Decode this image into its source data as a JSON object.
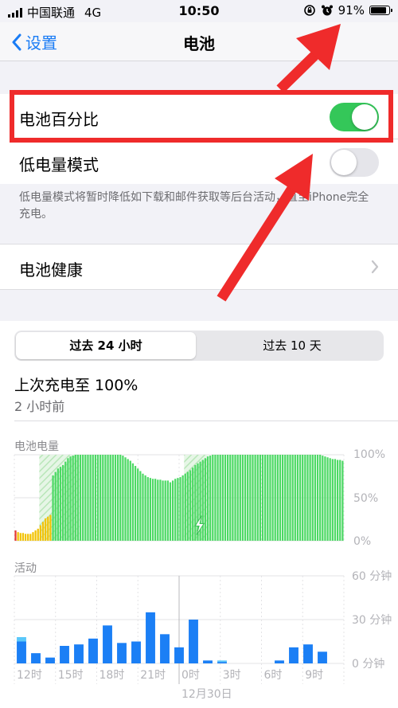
{
  "status_bar": {
    "carrier": "中国联通",
    "network": "4G",
    "time": "10:50",
    "battery_percent": "91%",
    "battery_level": 0.91
  },
  "nav": {
    "back_label": "设置",
    "title": "电池"
  },
  "settings": {
    "battery_percentage": {
      "label": "电池百分比",
      "on": true
    },
    "low_power_mode": {
      "label": "低电量模式",
      "on": false
    },
    "low_power_note": "低电量模式将暂时降低如下载和邮件获取等后台活动，直至iPhone完全充电。",
    "battery_health": {
      "label": "电池健康"
    }
  },
  "usage": {
    "tabs": [
      "过去 24 小时",
      "过去 10 天"
    ],
    "selected_tab": 0,
    "last_charge_title": "上次充电至 100%",
    "last_charge_ago": "2 小时前",
    "battery_level_label": "电池电量",
    "activity_label": "活动",
    "date_label": "12月30日"
  },
  "colors": {
    "accent": "#1a7cf5",
    "toggle_on": "#34c759",
    "toggle_off": "#e5e5ea",
    "battery_green": "#4cd964",
    "battery_yellow": "#f2c200",
    "battery_red": "#e53935",
    "activity_blue": "#1b7ff5",
    "activity_light_blue": "#5ac8fa",
    "annotation_red": "#ef2b2b"
  },
  "chart_data": [
    {
      "type": "bar",
      "title": "电池电量",
      "y_ticks": [
        "100%",
        "50%",
        "0%"
      ],
      "ylim": [
        0,
        100
      ],
      "grid": true,
      "values": [
        12,
        10,
        9,
        9,
        8,
        8,
        8,
        10,
        12,
        14,
        18,
        22,
        26,
        28,
        30,
        76,
        80,
        84,
        86,
        88,
        92,
        96,
        98,
        99,
        100,
        100,
        100,
        100,
        100,
        100,
        100,
        100,
        100,
        100,
        100,
        100,
        100,
        100,
        100,
        100,
        100,
        100,
        100,
        99,
        97,
        95,
        93,
        90,
        87,
        84,
        81,
        78,
        76,
        74,
        73,
        72,
        72,
        71,
        71,
        70,
        70,
        70,
        68,
        70,
        72,
        73,
        74,
        76,
        78,
        80,
        82,
        85,
        88,
        90,
        92,
        94,
        96,
        98,
        99,
        100,
        100,
        100,
        100,
        100,
        100,
        100,
        100,
        100,
        100,
        100,
        100,
        100,
        100,
        100,
        100,
        100,
        100,
        100,
        100,
        100,
        100,
        100,
        100,
        100,
        100,
        100,
        100,
        100,
        100,
        100,
        100,
        100,
        100,
        100,
        100,
        100,
        100,
        100,
        100,
        100,
        100,
        100,
        100,
        99,
        98,
        97,
        96,
        95,
        95,
        94,
        94,
        93
      ],
      "color_codes": [
        3,
        2,
        2,
        2,
        2,
        2,
        2,
        2,
        2,
        2,
        2,
        2,
        2,
        2,
        2,
        1,
        1,
        1,
        1,
        1,
        1,
        1,
        1,
        1,
        1,
        1,
        1,
        1,
        1,
        1,
        1,
        1,
        1,
        1,
        1,
        1,
        1,
        1,
        1,
        1,
        1,
        1,
        1,
        1,
        1,
        1,
        1,
        1,
        1,
        1,
        1,
        1,
        1,
        1,
        1,
        1,
        1,
        1,
        1,
        1,
        1,
        1,
        1,
        1,
        1,
        1,
        1,
        1,
        1,
        1,
        1,
        1,
        1,
        1,
        1,
        1,
        1,
        1,
        1,
        1,
        1,
        1,
        1,
        1,
        1,
        1,
        1,
        1,
        1,
        1,
        1,
        1,
        1,
        1,
        1,
        1,
        1,
        1,
        1,
        1,
        1,
        1,
        1,
        1,
        1,
        1,
        1,
        1,
        1,
        1,
        1,
        1,
        1,
        1,
        1,
        1,
        1,
        1,
        1,
        1,
        1,
        1,
        1,
        1,
        1,
        1,
        1,
        1,
        1,
        1,
        1,
        1,
        1
      ],
      "charging_ranges": [
        [
          10,
          26
        ],
        [
          68,
          78
        ]
      ]
    },
    {
      "type": "bar",
      "title": "活动",
      "y_ticks": [
        "60 分钟",
        "30 分钟",
        "0 分钟"
      ],
      "ylim": [
        0,
        60
      ],
      "grid": true,
      "categories": [
        "12时",
        "",
        "",
        "15时",
        "",
        "",
        "18时",
        "",
        "",
        "21时",
        "",
        "",
        "0时",
        "",
        "",
        "3时",
        "",
        "",
        "6时",
        "",
        "",
        "9时",
        ""
      ],
      "x_tick_labels": [
        "12时",
        "15时",
        "18时",
        "21时",
        "0时",
        "3时",
        "6时",
        "9时"
      ],
      "screen_on": [
        15,
        7,
        4,
        12,
        13,
        17,
        26,
        14,
        15,
        35,
        20,
        11,
        30,
        2,
        1,
        0,
        0,
        0,
        2,
        11,
        13,
        8,
        0
      ],
      "screen_off": [
        3,
        0,
        0,
        0,
        0,
        0,
        0,
        0,
        0,
        0,
        0,
        0,
        0,
        0,
        1,
        0,
        0,
        0,
        0,
        0,
        0,
        0,
        0
      ]
    }
  ]
}
